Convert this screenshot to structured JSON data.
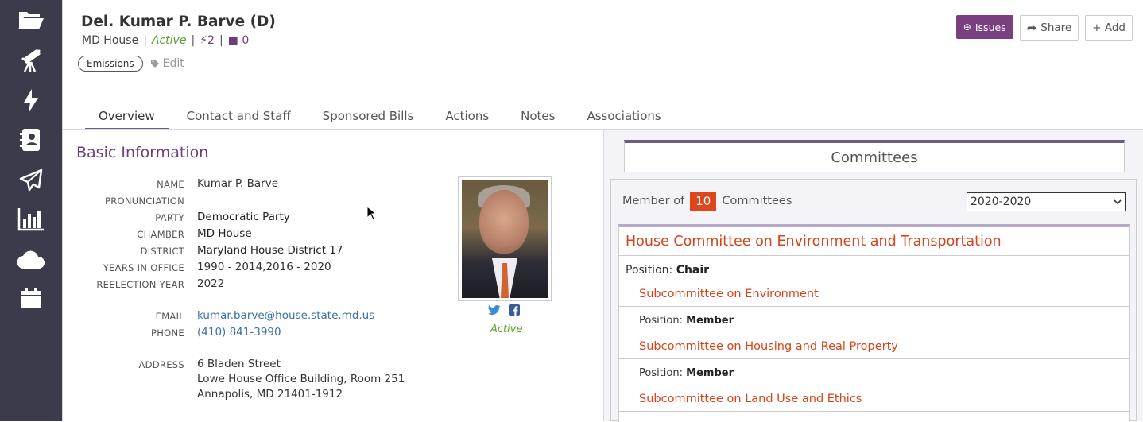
{
  "sidebar": {
    "items": [
      "folder-open-icon",
      "telescope-icon",
      "bolt-icon",
      "address-book-icon",
      "paper-plane-icon",
      "bar-chart-icon",
      "cloud-icon",
      "calendar-icon"
    ]
  },
  "header": {
    "title": "Del. Kumar P. Barve (D)",
    "chamber": "MD House",
    "status": "Active",
    "bills_count": "2",
    "notes_count": "0",
    "tag": "Emissions",
    "edit_label": "Edit"
  },
  "actions": {
    "issues_label": "Issues",
    "share_label": "Share",
    "add_label": "+ Add"
  },
  "tabs": [
    {
      "label": "Overview",
      "active": true
    },
    {
      "label": "Contact and Staff"
    },
    {
      "label": "Sponsored Bills"
    },
    {
      "label": "Actions"
    },
    {
      "label": "Notes"
    },
    {
      "label": "Associations"
    }
  ],
  "basic_info": {
    "title": "Basic Information",
    "name_label": "NAME",
    "name": "Kumar P. Barve",
    "pronunciation_label": "PRONUNCIATION",
    "party_label": "PARTY",
    "party": "Democratic Party",
    "chamber_label": "CHAMBER",
    "chamber": "MD House",
    "district_label": "DISTRICT",
    "district": "Maryland House District 17",
    "years_label": "YEARS IN OFFICE",
    "years": "1990 - 2014,2016 - 2020",
    "reelection_label": "REELECTION YEAR",
    "reelection": "2022",
    "email_label": "EMAIL",
    "email": "kumar.barve@house.state.md.us",
    "phone_label": "PHONE",
    "phone": "(410) 841-3990",
    "address_label": "ADDRESS",
    "address_line1": "6 Bladen Street",
    "address_line2": "Lowe House Office Building, Room 251",
    "address_line3": "Annapolis, MD 21401-1912",
    "photo_status": "Active"
  },
  "committees": {
    "title": "Committees",
    "member_of_label": "Member of",
    "count": "10",
    "committees_label": "Committees",
    "year_selected": "2020-2020",
    "main_committee": "House Committee on Environment and Transportation",
    "position_label": "Position:",
    "main_position": "Chair",
    "subcommittees": [
      {
        "name": "Subcommittee on Environment",
        "position": "Member"
      },
      {
        "name": "Subcommittee on Housing and Real Property",
        "position": "Member"
      },
      {
        "name": "Subcommittee on Land Use and Ethics",
        "position": "Member"
      }
    ]
  },
  "colors": {
    "sidebar": "#3b3b4c",
    "accent": "#6b3f7d",
    "committee_link": "#d6431a",
    "active_green": "#5aa02c"
  }
}
